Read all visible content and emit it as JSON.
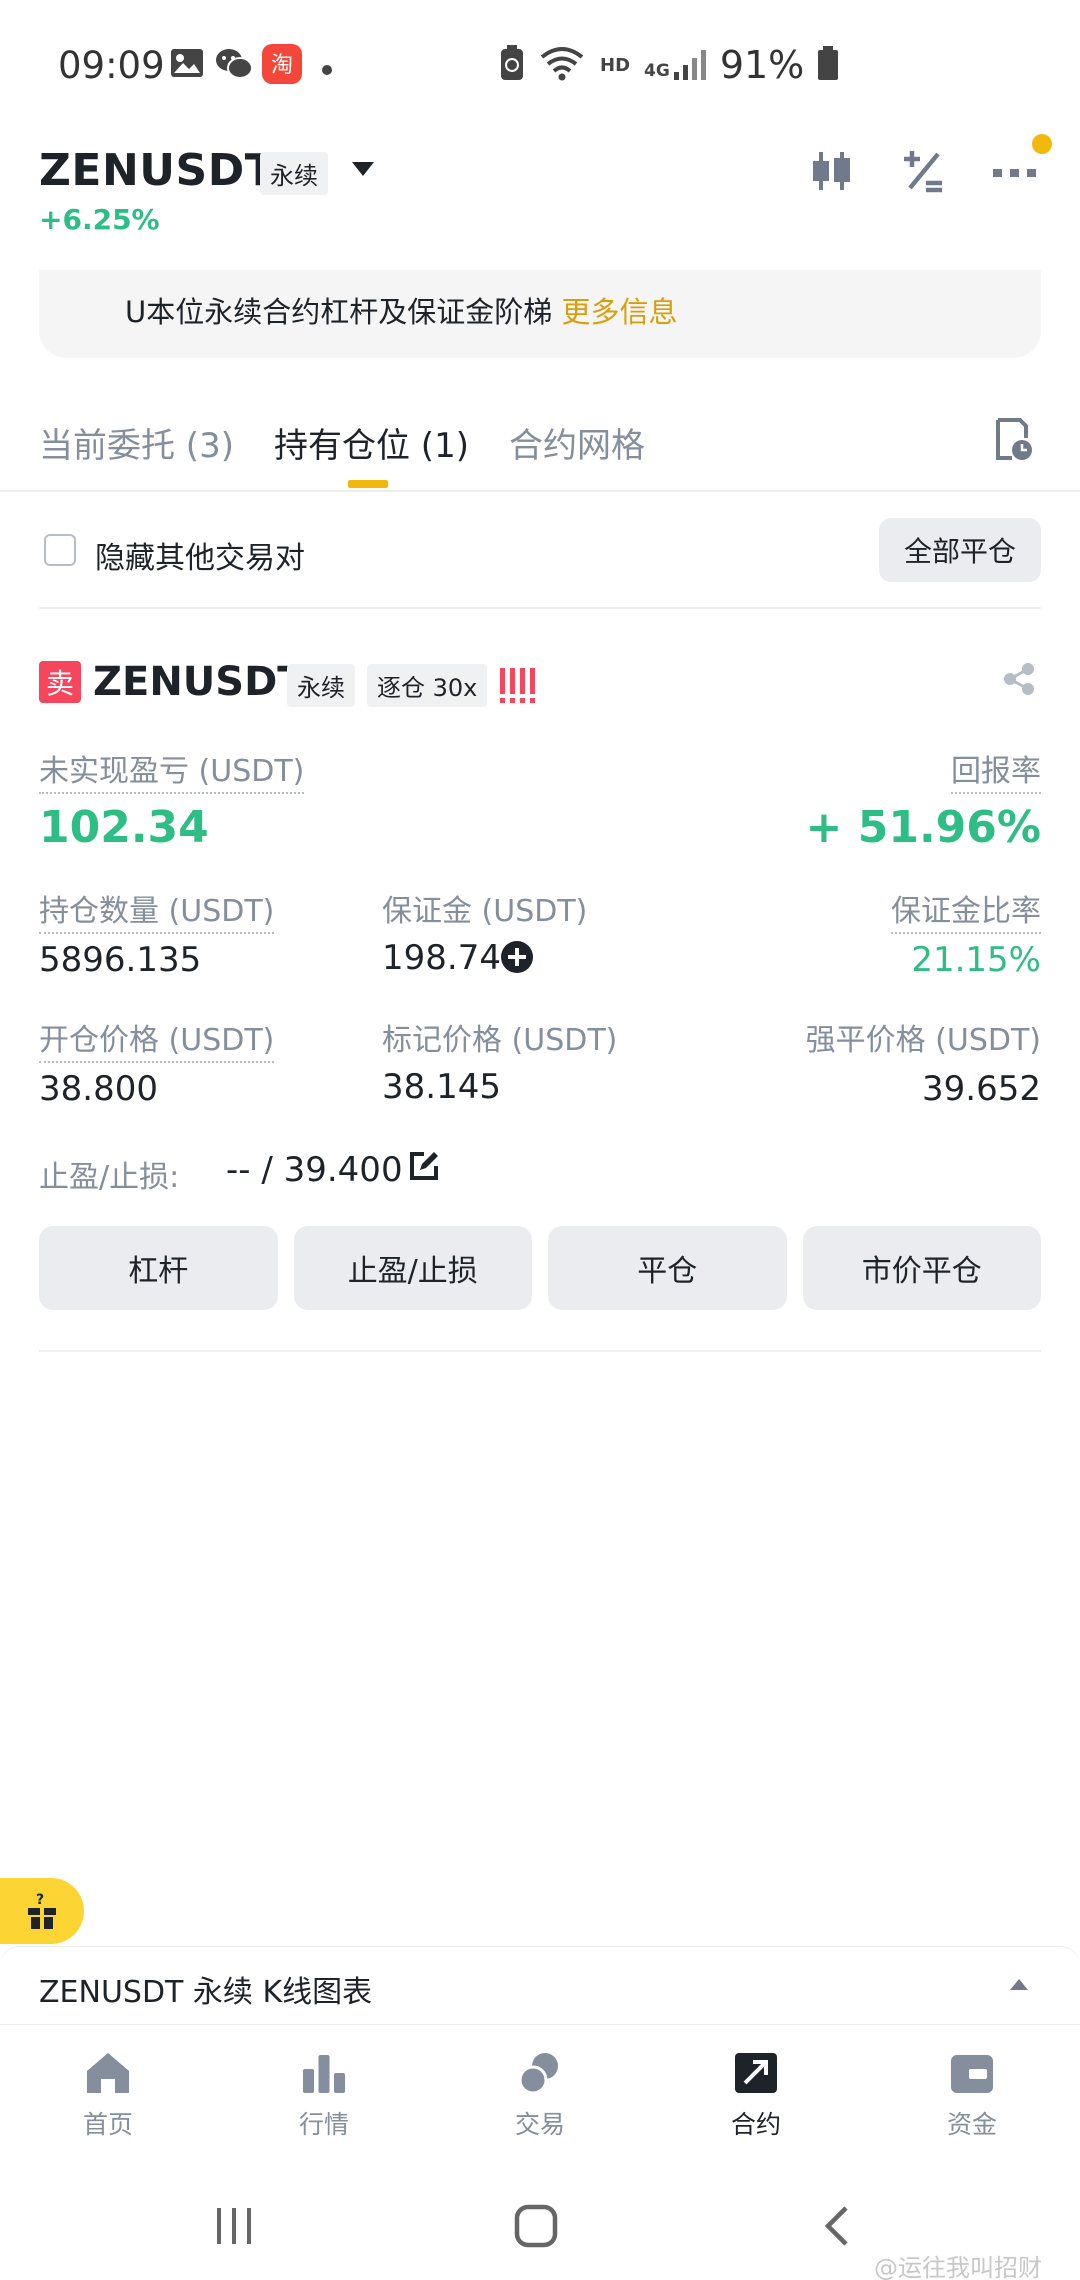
{
  "status_bar": {
    "time": "09:09",
    "battery": "91%",
    "signal": "4G",
    "hd": "HD",
    "icons": [
      "gallery-icon",
      "wechat-icon",
      "taobao-icon",
      "dot-icon",
      "battery-saver-icon",
      "wifi-icon",
      "signal-icon",
      "battery-icon"
    ]
  },
  "header": {
    "symbol": "ZENUSDT",
    "contract_type": "永续",
    "change": "+6.25%",
    "icons": [
      "candlestick-chart-icon",
      "calculator-icon",
      "more-icon"
    ]
  },
  "notice": {
    "text": "U本位永续合约杠杆及保证金阶梯",
    "link": "更多信息"
  },
  "tabs": [
    {
      "label": "当前委托 (3)",
      "active": false
    },
    {
      "label": "持有仓位 (1)",
      "active": true
    },
    {
      "label": "合约网格",
      "active": false
    }
  ],
  "filter": {
    "hide_other_pairs": "隐藏其他交易对",
    "close_all": "全部平仓"
  },
  "position": {
    "side": "卖",
    "symbol": "ZENUSDT",
    "contract_type": "永续",
    "margin_mode": "逐仓 30x",
    "unrealized_pnl_label": "未实现盈亏 (USDT)",
    "unrealized_pnl": "102.34",
    "roe_label": "回报率",
    "roe": "+ 51.96%",
    "size_label": "持仓数量 (USDT)",
    "size": "5896.135",
    "margin_label": "保证金 (USDT)",
    "margin": "198.74",
    "margin_ratio_label": "保证金比率",
    "margin_ratio": "21.15%",
    "entry_price_label": "开仓价格 (USDT)",
    "entry_price": "38.800",
    "mark_price_label": "标记价格 (USDT)",
    "mark_price": "38.145",
    "liq_price_label": "强平价格 (USDT)",
    "liq_price": "39.652",
    "tpsl_label": "止盈/止损:",
    "tpsl_value": "-- / 39.400",
    "buttons": [
      "杠杆",
      "止盈/止损",
      "平仓",
      "市价平仓"
    ]
  },
  "kline_bar": {
    "title": "ZENUSDT 永续 K线图表"
  },
  "bottom_nav": [
    {
      "label": "首页",
      "icon": "home-icon",
      "active": false
    },
    {
      "label": "行情",
      "icon": "markets-icon",
      "active": false
    },
    {
      "label": "交易",
      "icon": "trade-icon",
      "active": false
    },
    {
      "label": "合约",
      "icon": "futures-icon",
      "active": true
    },
    {
      "label": "资金",
      "icon": "wallet-icon",
      "active": false
    }
  ],
  "watermark": "@运往我叫招财"
}
